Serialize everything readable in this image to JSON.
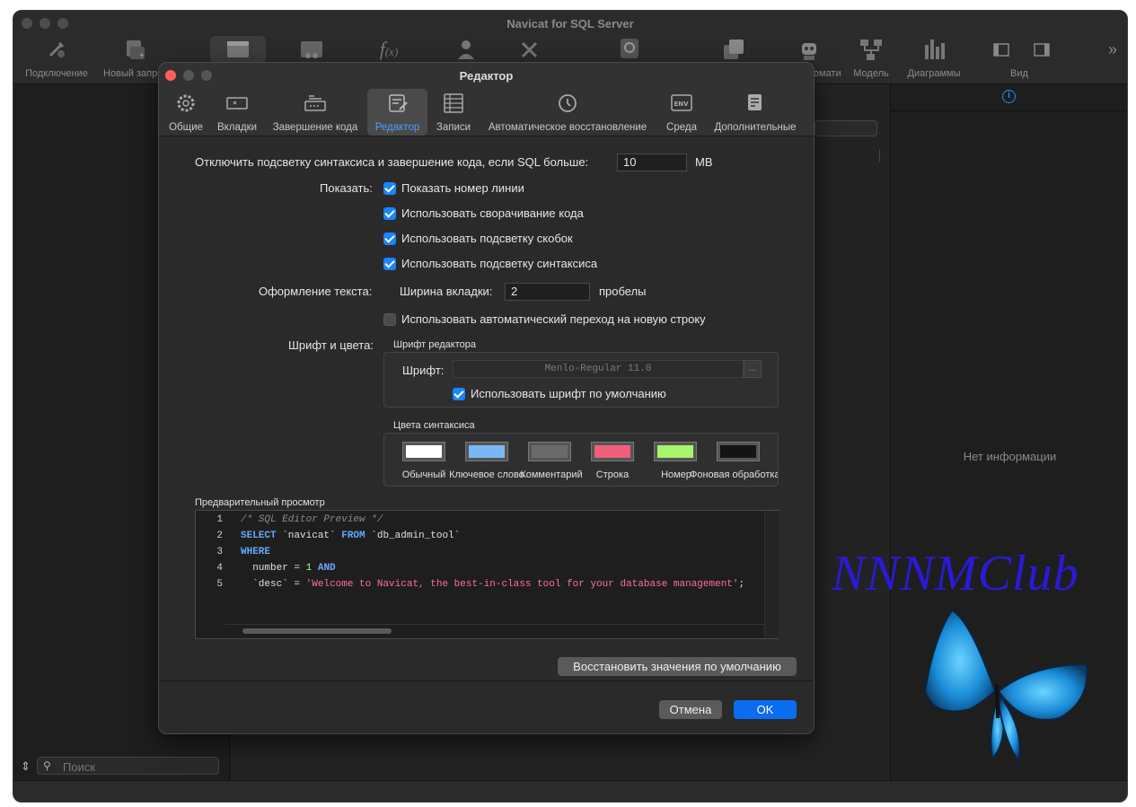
{
  "app": {
    "title": "Navicat for SQL Server",
    "toolbar": [
      {
        "label": "Подключение",
        "icon": "plug-icon"
      },
      {
        "label": "Новый запрос",
        "icon": "new-query-icon"
      },
      {
        "label": "",
        "icon": "table-icon"
      },
      {
        "label": "",
        "icon": "view-icon"
      },
      {
        "label": "",
        "icon": "function-icon"
      },
      {
        "label": "",
        "icon": "user-icon"
      },
      {
        "label": "",
        "icon": "tools-icon"
      },
      {
        "label": "",
        "icon": "restore-icon"
      },
      {
        "label": "",
        "icon": "queries-icon"
      },
      {
        "label": "Автоматизация",
        "icon": "robot-icon"
      },
      {
        "label": "Модель",
        "icon": "model-icon"
      },
      {
        "label": "Диаграммы",
        "icon": "charts-icon"
      },
      {
        "label": "Вид",
        "icon": "sidebar-left-icon"
      },
      {
        "label": "",
        "icon": "sidebar-right-icon"
      }
    ],
    "search_placeholder": "Поиск",
    "no_info": "Нет информации"
  },
  "dialog": {
    "title": "Редактор",
    "tabs": [
      {
        "label": "Общие",
        "icon": "gear-icon"
      },
      {
        "label": "Вкладки",
        "icon": "tabs-icon"
      },
      {
        "label": "Завершение кода",
        "icon": "code-completion-icon"
      },
      {
        "label": "Редактор",
        "icon": "editor-icon"
      },
      {
        "label": "Записи",
        "icon": "records-icon"
      },
      {
        "label": "Автоматическое восстановление",
        "icon": "history-icon"
      },
      {
        "label": "Среда",
        "icon": "env-icon"
      },
      {
        "label": "Дополнительные",
        "icon": "advanced-icon"
      }
    ],
    "active_tab": "Редактор",
    "disable_highlight_label": "Отключить подсветку синтаксиса и завершение кода, если SQL больше:",
    "disable_highlight_value": "10",
    "disable_highlight_unit": "MB",
    "show_label": "Показать:",
    "show_options": [
      {
        "label": "Показать номер линии",
        "checked": true
      },
      {
        "label": "Использовать сворачивание кода",
        "checked": true
      },
      {
        "label": "Использовать подсветку скобок",
        "checked": true
      },
      {
        "label": "Использовать подсветку синтаксиса",
        "checked": true
      }
    ],
    "text_format_label": "Оформление текста:",
    "tab_width_label": "Ширина вкладки:",
    "tab_width_value": "2",
    "tab_width_unit": "пробелы",
    "word_wrap_label": "Использовать автоматический переход на новую строку",
    "word_wrap_checked": false,
    "font_colors_label": "Шрифт и цвета:",
    "editor_font_group": "Шрифт редактора",
    "font_label": "Шрифт:",
    "font_value": "Menlo-Regular 11.0",
    "font_browse": "...",
    "use_default_font_label": "Использовать шрифт по умолчанию",
    "use_default_font_checked": true,
    "syntax_colors_group": "Цвета синтаксиса",
    "syntax_colors": [
      {
        "label": "Обычный",
        "color": "#ffffff"
      },
      {
        "label": "Ключевое слово",
        "color": "#7ab8f5"
      },
      {
        "label": "Комментарий",
        "color": "#6a6a6a"
      },
      {
        "label": "Строка",
        "color": "#f0607c"
      },
      {
        "label": "Номер",
        "color": "#a8f56a"
      },
      {
        "label": "Фоновая обработка",
        "color": "#141414"
      }
    ],
    "preview_label": "Предварительный просмотр",
    "preview_lines": [
      {
        "n": "1",
        "parts": [
          {
            "t": "/* SQL Editor Preview */",
            "c": "cm"
          }
        ]
      },
      {
        "n": "2",
        "parts": [
          {
            "t": "SELECT",
            "c": "kw"
          },
          {
            "t": " `navicat` ",
            "c": ""
          },
          {
            "t": "FROM",
            "c": "kw"
          },
          {
            "t": " `db_admin_tool`",
            "c": ""
          }
        ]
      },
      {
        "n": "3",
        "parts": [
          {
            "t": "WHERE",
            "c": "kw"
          }
        ]
      },
      {
        "n": "4",
        "parts": [
          {
            "t": "  number = ",
            "c": ""
          },
          {
            "t": "1",
            "c": "num"
          },
          {
            "t": " ",
            "c": ""
          },
          {
            "t": "AND",
            "c": "kw"
          }
        ]
      },
      {
        "n": "5",
        "parts": [
          {
            "t": "  `desc` = ",
            "c": ""
          },
          {
            "t": "'Welcome to Navicat, the best-in-class tool for your database management'",
            "c": "str"
          },
          {
            "t": ";",
            "c": ""
          }
        ]
      }
    ],
    "restore_defaults": "Восстановить значения по умолчанию",
    "cancel": "Отмена",
    "ok": "OK"
  },
  "watermark": "NNNMClub"
}
